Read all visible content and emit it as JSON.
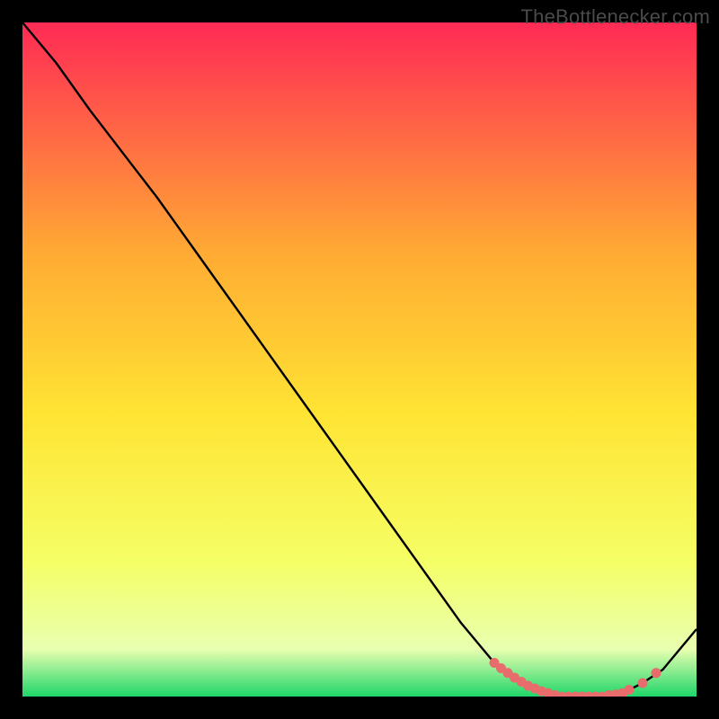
{
  "watermark": "TheBottlenecker.com",
  "colors": {
    "page_bg": "#000000",
    "watermark": "#4a4a4a",
    "line": "#000000",
    "marker": "#e86c6c",
    "gradient_top": "#ff2a55",
    "gradient_mid_top": "#ffad33",
    "gradient_mid": "#ffe433",
    "gradient_low": "#f5ff66",
    "gradient_pale": "#e8ffb0",
    "gradient_bottom": "#1fd66a"
  },
  "chart_data": {
    "type": "line",
    "title": "",
    "xlabel": "",
    "ylabel": "",
    "xlim": [
      0,
      100
    ],
    "ylim": [
      0,
      100
    ],
    "series": [
      {
        "name": "bottleneck-curve",
        "x": [
          0,
          5,
          10,
          15,
          20,
          25,
          30,
          35,
          40,
          45,
          50,
          55,
          60,
          65,
          70,
          73,
          76,
          80,
          83,
          86,
          89,
          92,
          95,
          100
        ],
        "y": [
          100,
          94,
          87,
          80.5,
          74,
          67,
          60,
          53,
          46,
          39,
          32,
          25,
          18,
          11,
          5,
          2.5,
          1,
          0,
          0,
          0,
          0.5,
          2,
          4,
          10
        ]
      }
    ],
    "markers": {
      "name": "highlight-points",
      "x": [
        70,
        71,
        72,
        73,
        74,
        75,
        76,
        77,
        78,
        79,
        80,
        81,
        82,
        83,
        84,
        85,
        86,
        87,
        88,
        89,
        90,
        92,
        94
      ],
      "y": [
        5,
        4.2,
        3.5,
        2.8,
        2.2,
        1.6,
        1.2,
        0.8,
        0.5,
        0.2,
        0,
        0,
        0,
        0,
        0,
        0,
        0,
        0.2,
        0.3,
        0.5,
        1,
        2,
        3.5
      ]
    }
  }
}
